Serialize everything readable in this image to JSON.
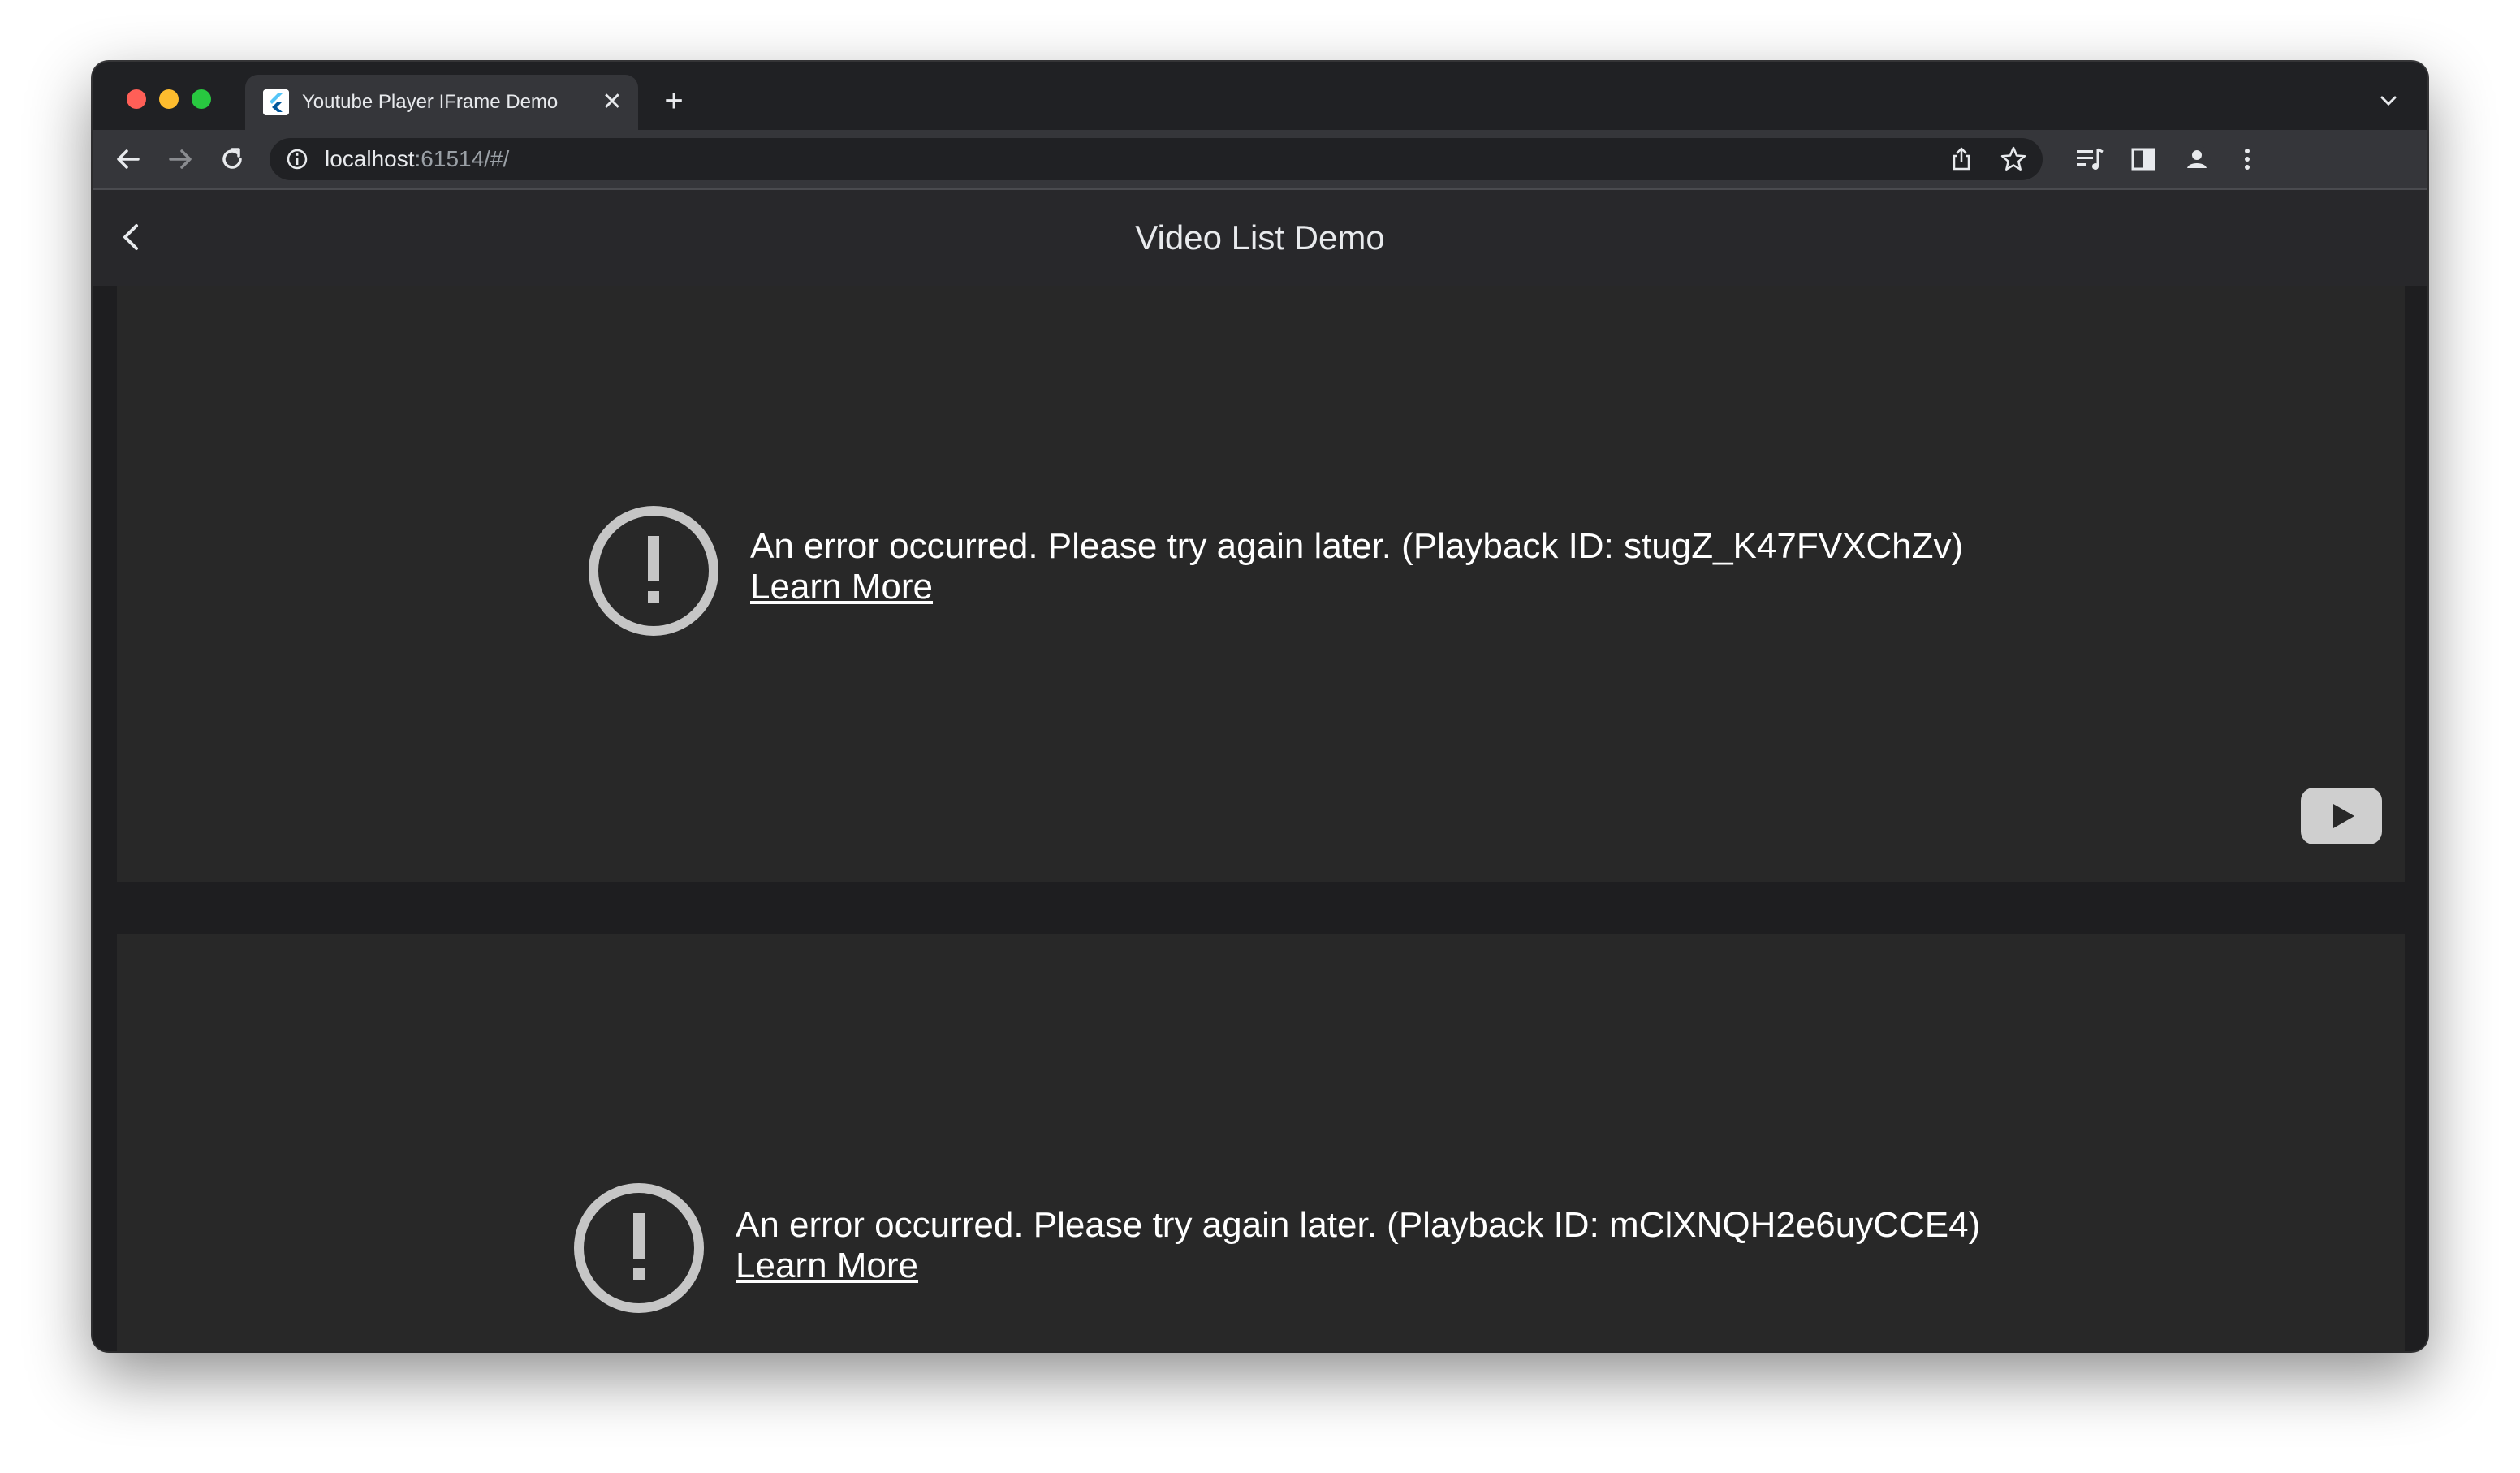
{
  "browser": {
    "tab_title": "Youtube Player IFrame Demo",
    "tab_close": "✕",
    "new_tab": "+",
    "url_host": "localhost",
    "url_rest": ":61514/#/"
  },
  "app": {
    "title": "Video List Demo"
  },
  "players": [
    {
      "error_message": "An error occurred. Please try again later. (Playback ID: stugZ_K47FVXChZv)",
      "learn_more": "Learn More"
    },
    {
      "error_message": "An error occurred. Please try again later. (Playback ID: mClXNQH2e6uyCCE4)",
      "learn_more": "Learn More"
    }
  ],
  "icons": {
    "close": "close-icon",
    "new_tab": "plus-icon",
    "tab_menu": "chevron-down-icon",
    "back": "arrow-left-icon",
    "forward": "arrow-right-icon",
    "reload": "reload-icon",
    "site_info": "info-icon",
    "share": "share-icon",
    "bookmark": "star-icon",
    "reading_list": "reading-list-icon",
    "side_panel": "side-panel-icon",
    "profile": "profile-icon",
    "menu": "more-vert-icon",
    "appbar_back": "chevron-left-icon",
    "error": "error-icon",
    "youtube": "youtube-logo-icon"
  },
  "colors": {
    "window_bg": "#202124",
    "toolbar_bg": "#35363a",
    "appbar_bg": "#28282b",
    "player_bg": "#282828",
    "error_icon": "#c6c6c6",
    "text": "#ffffff"
  }
}
